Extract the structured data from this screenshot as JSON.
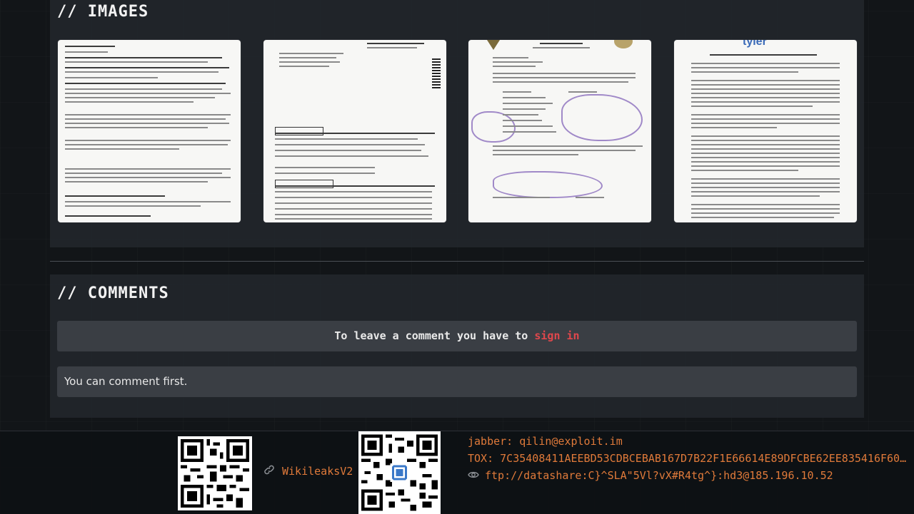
{
  "images_section": {
    "title": "// IMAGES",
    "images": [
      {
        "name": "police-report-scan"
      },
      {
        "name": "bank-statement-scan"
      },
      {
        "name": "sheriff-letter-scan"
      },
      {
        "name": "nda-agreement-scan",
        "logo_text": "tyler"
      }
    ]
  },
  "comments_section": {
    "title": "// COMMENTS",
    "signin_prompt": "To leave a comment you have to",
    "signin_link": "sign in",
    "empty_message": "You can comment first."
  },
  "footer": {
    "wiki_link": "WikileaksV2",
    "jabber": "jabber: qilin@exploit.im",
    "tox": "TOX: 7C35408411AEEBD53CDBCEBAB167D7B22F1E66614E89DFCBE62EE835416F60E1BC…",
    "ftp": "ftp://datashare:C}^SLA\"5Vl?vX#R4tg^}:hd3@185.196.10.52"
  },
  "colors": {
    "accent_orange": "#e07a3a",
    "signin_red": "#e0474c",
    "panel": "#22262b"
  }
}
